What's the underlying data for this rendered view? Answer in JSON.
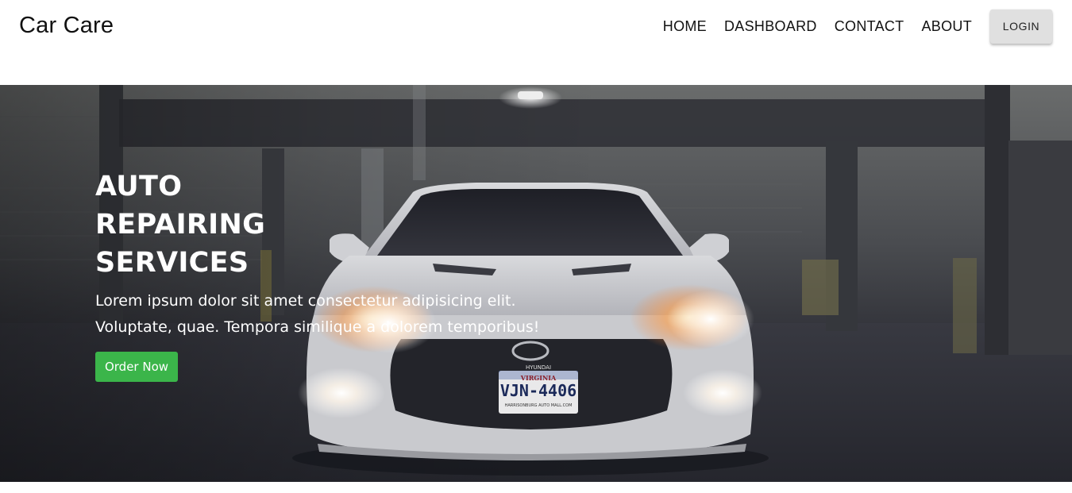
{
  "header": {
    "brand": "Car Care",
    "nav": {
      "home": "HOME",
      "dashboard": "DASHBOARD",
      "contact": "CONTACT",
      "about": "ABOUT"
    },
    "login_label": "LOGIN"
  },
  "hero": {
    "title": "AUTO REPAIRING SERVICES",
    "text": "Lorem ipsum dolor sit amet consectetur adipisicing elit. Voluptate, quae. Tempora similique a dolorem temporibus!",
    "cta_label": "Order Now",
    "plate_text": "VJN-4406",
    "plate_state": "VIRGINIA",
    "plate_dealer": "HARRISONBURG AUTO MALL.COM",
    "car_badge": "HYUNDAI"
  },
  "colors": {
    "cta_green": "#3bb54a",
    "login_bg": "#e0e0e0",
    "hero_overlay": "#2b2c33"
  }
}
